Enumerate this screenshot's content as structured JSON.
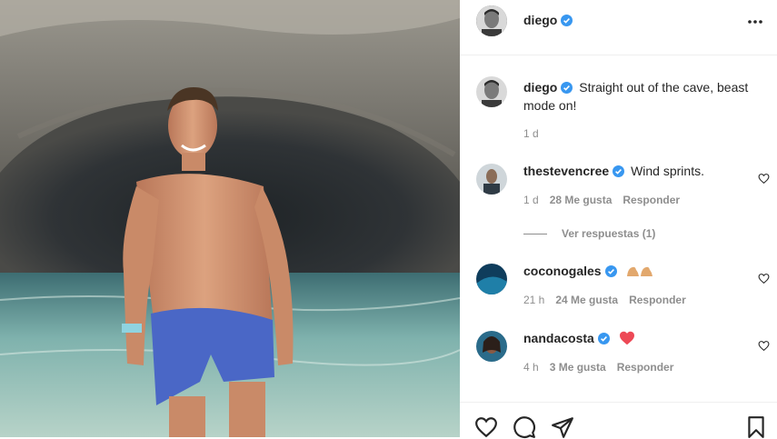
{
  "header": {
    "username": "diego",
    "verified": true,
    "more_icon": "more-horizontal-icon"
  },
  "caption": {
    "username": "diego",
    "text": "Straight out of the cave, beast mode on!",
    "time": "1 d"
  },
  "comments": [
    {
      "username": "thestevencree",
      "text": "Wind sprints.",
      "time": "1 d",
      "likes": "28 Me gusta",
      "reply": "Responder",
      "view_replies": "Ver respuestas (1)"
    },
    {
      "username": "coconogales",
      "text": "",
      "emoji": "flexed-biceps-emoji",
      "time": "21 h",
      "likes": "24 Me gusta",
      "reply": "Responder"
    },
    {
      "username": "nandacosta",
      "text": "",
      "emoji": "red-heart-emoji",
      "time": "4 h",
      "likes": "3 Me gusta",
      "reply": "Responder"
    }
  ],
  "colors": {
    "verified_blue": "#3897f0",
    "meta_gray": "#8e8e8e",
    "text": "#262626",
    "heart_red": "#ed4956"
  },
  "actions": [
    "like-icon",
    "comment-icon",
    "share-icon",
    "save-icon"
  ]
}
